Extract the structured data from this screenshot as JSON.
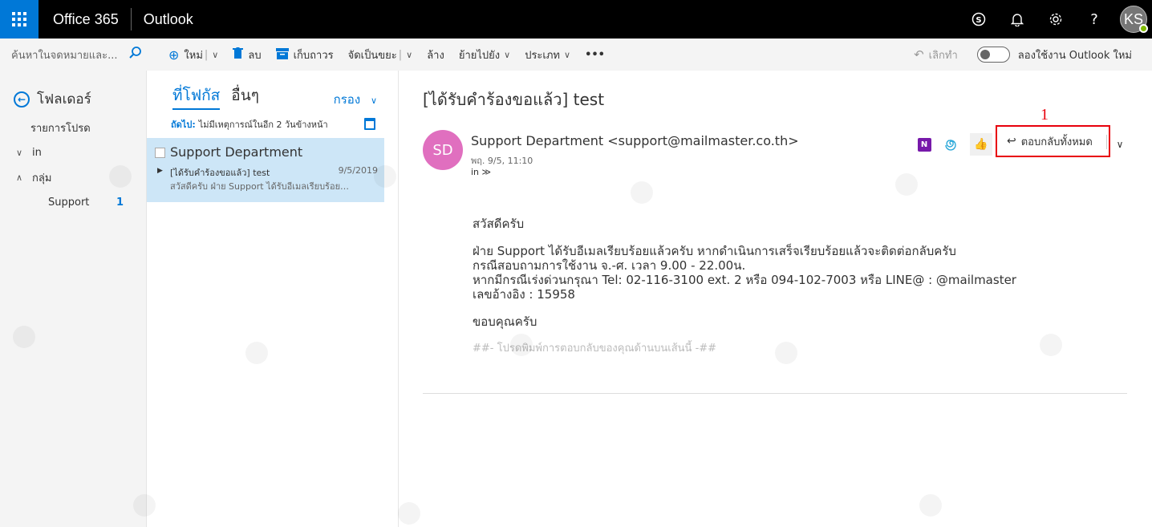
{
  "topbar": {
    "brand": "Office 365",
    "app_name": "Outlook",
    "avatar_initials": "KS"
  },
  "commands": {
    "search_placeholder": "ค้นหาในจดหมายและ...",
    "new_label": "ใหม่",
    "delete_label": "ลบ",
    "archive_label": "เก็บถาวร",
    "junk_label": "จัดเป็นขยะ",
    "sweep_label": "ล้าง",
    "move_label": "ย้ายไปยัง",
    "categorize_label": "ประเภท",
    "more_label": "•••",
    "undo_label": "เลิกทำ",
    "try_new_label": "ลองใช้งาน Outlook ใหม่"
  },
  "folders": {
    "header": "โฟลเดอร์",
    "favorites": "รายการโปรด",
    "inbox": "in",
    "groups": "กลุ่ม",
    "group_items": [
      {
        "label": "Support",
        "count": "1"
      }
    ]
  },
  "list": {
    "tab_focused": "ที่โฟกัส",
    "tab_other": "อื่นๆ",
    "filter_label": "กรอง",
    "next_label": "ถัดไป:",
    "next_text": "ไม่มีเหตุการณ์ในอีก 2 วันข้างหน้า",
    "messages": [
      {
        "sender": "Support Department",
        "subject": "[ได้รับคำร้องขอแล้ว] test",
        "date": "9/5/2019",
        "preview": "สวัสดีครับ  ฝ่าย Support ได้รับอีเมลเรียบร้อยแล้วครับ"
      }
    ]
  },
  "reading": {
    "subject": "[ได้รับคำร้องขอแล้ว] test",
    "avatar_initials": "SD",
    "avatar_color": "#e06fbf",
    "sender": "Support Department <support@mailmaster.co.th>",
    "sent": "พฤ. 9/5, 11:10",
    "to": "in ≫",
    "reply_all_label": "ตอบกลับทั้งหมด",
    "step_number": "1",
    "body": {
      "greeting": "สวัสดีครับ",
      "line1": "ฝ่าย Support ได้รับอีเมลเรียบร้อยแล้วครับ หากดำเนินการเสร็จเรียบร้อยแล้วจะติดต่อกลับครับ",
      "line2": "กรณีสอบถามการใช้งาน จ.-ศ. เวลา 9.00 - 22.00น.",
      "line3": "หากมีกรณีเร่งด่วนกรุณา Tel: 02-116-3100 ext. 2 หรือ 094-102-7003 หรือ LINE@ : @mailmaster",
      "line4": "เลขอ้างอิง : 15958",
      "thanks": "ขอบคุณครับ",
      "reply_note": "##- โปรดพิมพ์การตอบกลับของคุณด้านบนเส้นนี้ -##"
    }
  },
  "colors": {
    "accent": "#0078d7",
    "highlight": "#e8000b",
    "selected_row": "#cde6f7"
  }
}
